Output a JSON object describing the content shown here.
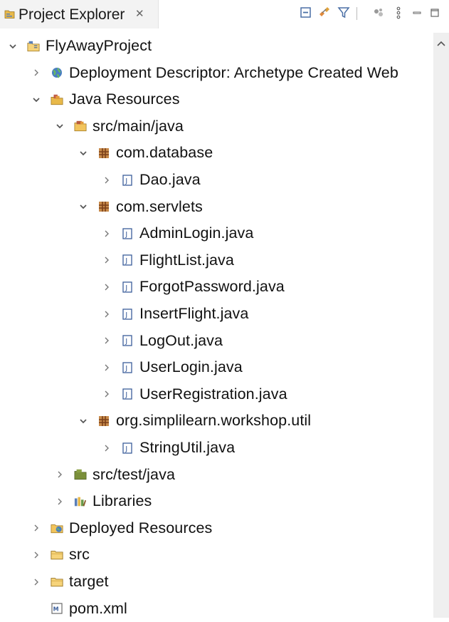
{
  "view": {
    "title": "Project Explorer",
    "close_glyph": "✕"
  },
  "toolbar": [
    "collapse-all-icon",
    "link-with-editor-icon",
    "filter-icon",
    "focus-icon",
    "view-menu-icon",
    "minimize-icon",
    "maximize-icon"
  ],
  "tree": [
    {
      "label": "FlyAwayProject",
      "icon": "project-icon",
      "expanded": true,
      "twisty": "expanded",
      "depth": 0
    },
    {
      "label": "Deployment Descriptor: Archetype Created Web",
      "icon": "globe-icon",
      "twisty": "collapsed",
      "depth": 1
    },
    {
      "label": "Java Resources",
      "icon": "java-resources-icon",
      "twisty": "expanded",
      "depth": 1
    },
    {
      "label": "src/main/java",
      "icon": "source-folder-icon",
      "twisty": "expanded",
      "depth": 2
    },
    {
      "label": "com.database",
      "icon": "package-icon",
      "twisty": "expanded",
      "depth": 3
    },
    {
      "label": "Dao.java",
      "icon": "java-file-icon",
      "twisty": "collapsed",
      "depth": 4
    },
    {
      "label": "com.servlets",
      "icon": "package-icon",
      "twisty": "expanded",
      "depth": 3
    },
    {
      "label": "AdminLogin.java",
      "icon": "java-file-icon",
      "twisty": "collapsed",
      "depth": 4
    },
    {
      "label": "FlightList.java",
      "icon": "java-file-icon",
      "twisty": "collapsed",
      "depth": 4
    },
    {
      "label": "ForgotPassword.java",
      "icon": "java-file-icon",
      "twisty": "collapsed",
      "depth": 4
    },
    {
      "label": "InsertFlight.java",
      "icon": "java-file-icon",
      "twisty": "collapsed",
      "depth": 4
    },
    {
      "label": "LogOut.java",
      "icon": "java-file-icon",
      "twisty": "collapsed",
      "depth": 4
    },
    {
      "label": "UserLogin.java",
      "icon": "java-file-icon",
      "twisty": "collapsed",
      "depth": 4
    },
    {
      "label": "UserRegistration.java",
      "icon": "java-file-icon",
      "twisty": "collapsed",
      "depth": 4
    },
    {
      "label": "org.simplilearn.workshop.util",
      "icon": "package-icon",
      "twisty": "expanded",
      "depth": 3
    },
    {
      "label": "StringUtil.java",
      "icon": "java-file-icon",
      "twisty": "collapsed",
      "depth": 4
    },
    {
      "label": "src/test/java",
      "icon": "test-source-folder-icon",
      "twisty": "collapsed",
      "depth": 2
    },
    {
      "label": "Libraries",
      "icon": "libraries-icon",
      "twisty": "collapsed",
      "depth": 2
    },
    {
      "label": "Deployed Resources",
      "icon": "deployed-resources-icon",
      "twisty": "collapsed",
      "depth": 1
    },
    {
      "label": "src",
      "icon": "folder-icon",
      "twisty": "collapsed",
      "depth": 1
    },
    {
      "label": "target",
      "icon": "folder-icon",
      "twisty": "collapsed",
      "depth": 1
    },
    {
      "label": "pom.xml",
      "icon": "xml-file-icon",
      "twisty": "none",
      "depth": 1
    }
  ],
  "colors": {
    "background": "#ffffff",
    "tab_background": "#f3f3f3",
    "folder": "#e8b94a",
    "package": "#a0522d",
    "java_file": "#3b5e9a",
    "twisty": "#555555"
  }
}
